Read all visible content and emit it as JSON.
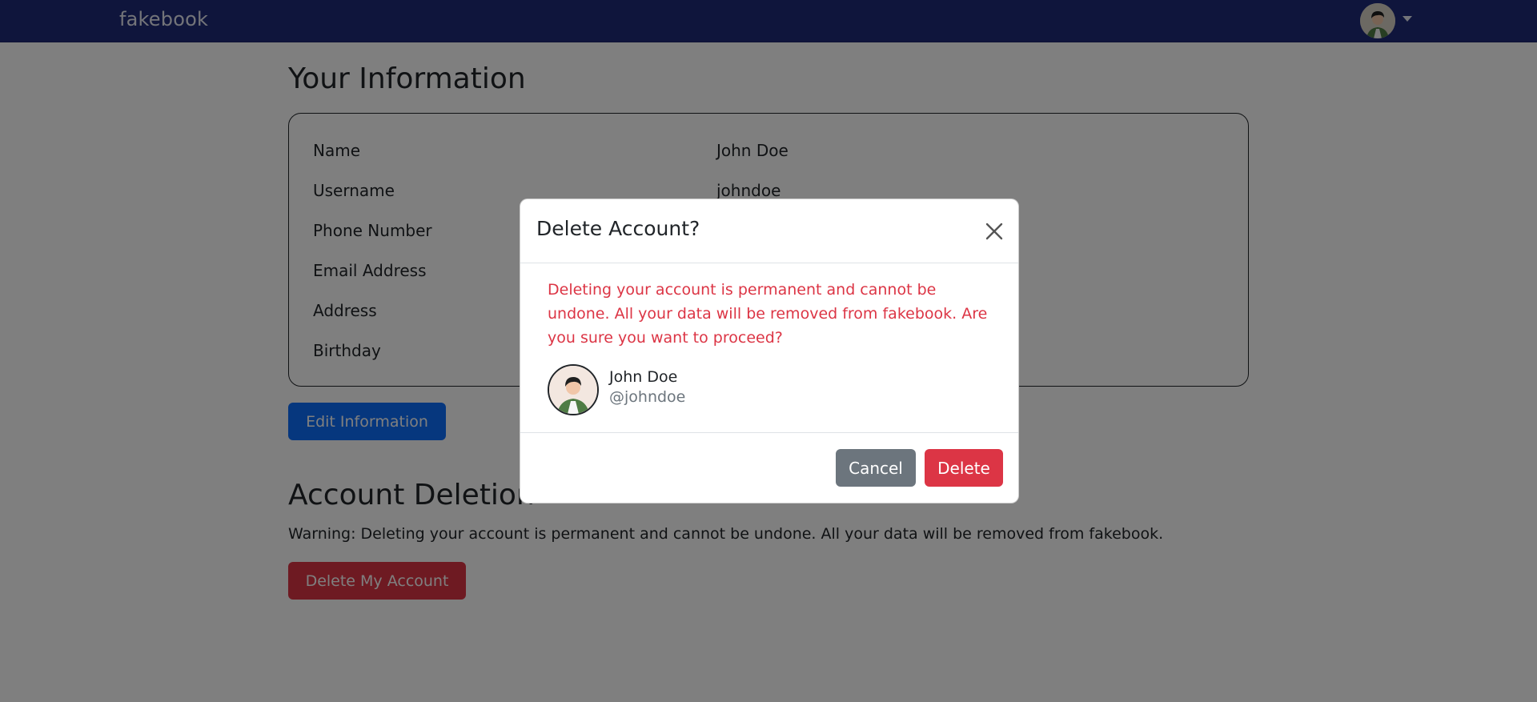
{
  "navbar": {
    "brand": "fakebook"
  },
  "page": {
    "title": "Your Information",
    "fields": [
      {
        "label": "Name",
        "value": "John Doe"
      },
      {
        "label": "Username",
        "value": "johndoe"
      },
      {
        "label": "Phone Number",
        "value": ""
      },
      {
        "label": "Email Address",
        "value": ""
      },
      {
        "label": "Address",
        "value": ""
      },
      {
        "label": "Birthday",
        "value": ""
      }
    ],
    "edit_button": "Edit Information",
    "deletion_title": "Account Deletion",
    "deletion_warning": "Warning: Deleting your account is permanent and cannot be undone. All your data will be removed from fakebook.",
    "delete_account_button": "Delete My Account"
  },
  "modal": {
    "title": "Delete Account?",
    "message": "Deleting your account is permanent and cannot be undone. All your data will be removed from fakebook. Are you sure you want to proceed?",
    "user": {
      "name": "John Doe",
      "handle": "@johndoe"
    },
    "cancel_button": "Cancel",
    "delete_button": "Delete"
  },
  "colors": {
    "navbar": "#1e2a78",
    "primary": "#0d6efd",
    "danger": "#dc3545",
    "secondary": "#6c757d"
  },
  "icons": {
    "close": "close-icon",
    "caret": "caret-down-icon",
    "avatar": "user-avatar-icon"
  }
}
